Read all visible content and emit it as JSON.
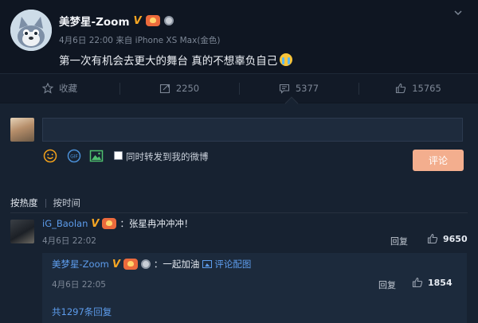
{
  "post": {
    "author": "美梦星-Zoom",
    "badges": {
      "verified": "V",
      "icons": [
        "verified-v-icon",
        "fan-badge-icon",
        "medal-icon"
      ]
    },
    "timestamp": "4月6日 22:00",
    "source": "来自 iPhone XS Max(金色)",
    "text": "第一次有机会去更大的舞台 真的不想辜负自己",
    "emoji": "crying-emoji-icon"
  },
  "actions": {
    "favorite_label": "收藏",
    "repost_count": "2250",
    "comment_count": "5377",
    "like_count": "15765"
  },
  "composer": {
    "input_value": "",
    "input_placeholder": "",
    "tools": [
      "emoji-icon",
      "gif-icon",
      "image-icon"
    ],
    "repost_label": "同时转发到我的微博",
    "submit_label": "评论"
  },
  "sort": {
    "hot_label": "按热度",
    "time_label": "按时间"
  },
  "comments": [
    {
      "user": "iG_Baolan",
      "text": "：张星冉冲冲冲！",
      "time": "4月6日 22:02",
      "reply_label": "回复",
      "likes": "9650",
      "replies": [
        {
          "user": "美梦星-Zoom",
          "text": "：一起加油",
          "link_label": "评论配图",
          "time": "4月6日 22:05",
          "reply_label": "回复",
          "likes": "1854"
        }
      ],
      "more_replies_label": "共1297条回复"
    }
  ],
  "colors": {
    "background": "#0f1622",
    "panel": "#172231",
    "link_blue": "#5d9cec",
    "submit_button": "#f3ae8e",
    "verified_gold": "#f6a623"
  }
}
